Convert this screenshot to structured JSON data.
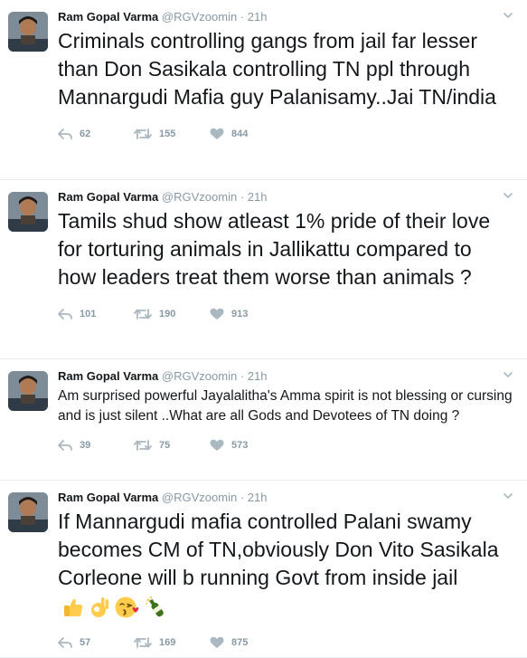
{
  "colors": {
    "text": "#14171a",
    "meta": "#8899a6",
    "divider": "#e6ecf0"
  },
  "tweets": [
    {
      "name": "Ram Gopal Varma",
      "handle": "@RGVzoomin",
      "separator": "·",
      "time": "21h",
      "text": "Criminals controlling gangs from jail far lesser than Don Sasikala controlling TN ppl through Mannargudi Mafia guy Palanisamy..Jai TN/india",
      "replies": "62",
      "retweets": "155",
      "likes": "844"
    },
    {
      "name": "Ram Gopal Varma",
      "handle": "@RGVzoomin",
      "separator": "·",
      "time": "21h",
      "text": "Tamils shud show atleast 1% pride of their love for torturing animals in Jallikattu compared to how leaders treat them worse than animals ?",
      "replies": "101",
      "retweets": "190",
      "likes": "913"
    },
    {
      "name": "Ram Gopal Varma",
      "handle": "@RGVzoomin",
      "separator": "·",
      "time": "21h",
      "text": "Am surprised powerful Jayalalitha's Amma spirit is not blessing or cursing and is just silent ..What are all Gods and Devotees of TN doing ?",
      "replies": "39",
      "retweets": "75",
      "likes": "573"
    },
    {
      "name": "Ram Gopal Varma",
      "handle": "@RGVzoomin",
      "separator": "·",
      "time": "21h",
      "text": "If Mannargudi mafia controlled Palani swamy becomes CM of TN,obviously Don Vito Sasikala Corleone will b running Govt from inside jail",
      "emojis": [
        "thumbs-up",
        "ok-hand",
        "kiss-face",
        "champagne"
      ],
      "replies": "57",
      "retweets": "169",
      "likes": "875"
    }
  ]
}
